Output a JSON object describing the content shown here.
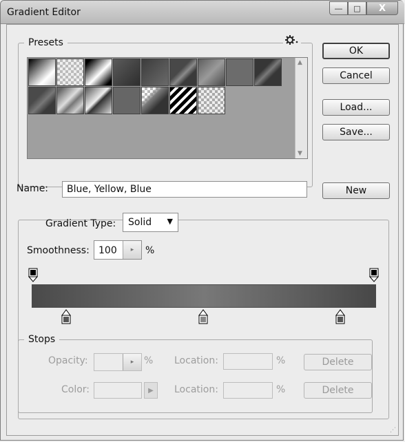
{
  "window": {
    "title": "Gradient Editor",
    "minimize_glyph": "―",
    "maximize_glyph": "□",
    "close_glyph": "X"
  },
  "presets": {
    "legend": "Presets",
    "menu_icon": "gear-icon"
  },
  "buttons": {
    "ok": "OK",
    "cancel": "Cancel",
    "load": "Load...",
    "save": "Save...",
    "new": "New"
  },
  "name_field": {
    "label": "Name:",
    "value": "Blue, Yellow, Blue"
  },
  "gradient_type": {
    "label": "Gradient Type:",
    "value": "Solid"
  },
  "smoothness": {
    "label": "Smoothness:",
    "value": "100",
    "unit": "%"
  },
  "stops": {
    "legend": "Stops",
    "opacity_label": "Opacity:",
    "opacity_unit": "%",
    "location_label_1": "Location:",
    "location_unit_1": "%",
    "delete_1": "Delete",
    "color_label": "Color:",
    "location_label_2": "Location:",
    "location_unit_2": "%",
    "delete_2": "Delete"
  }
}
